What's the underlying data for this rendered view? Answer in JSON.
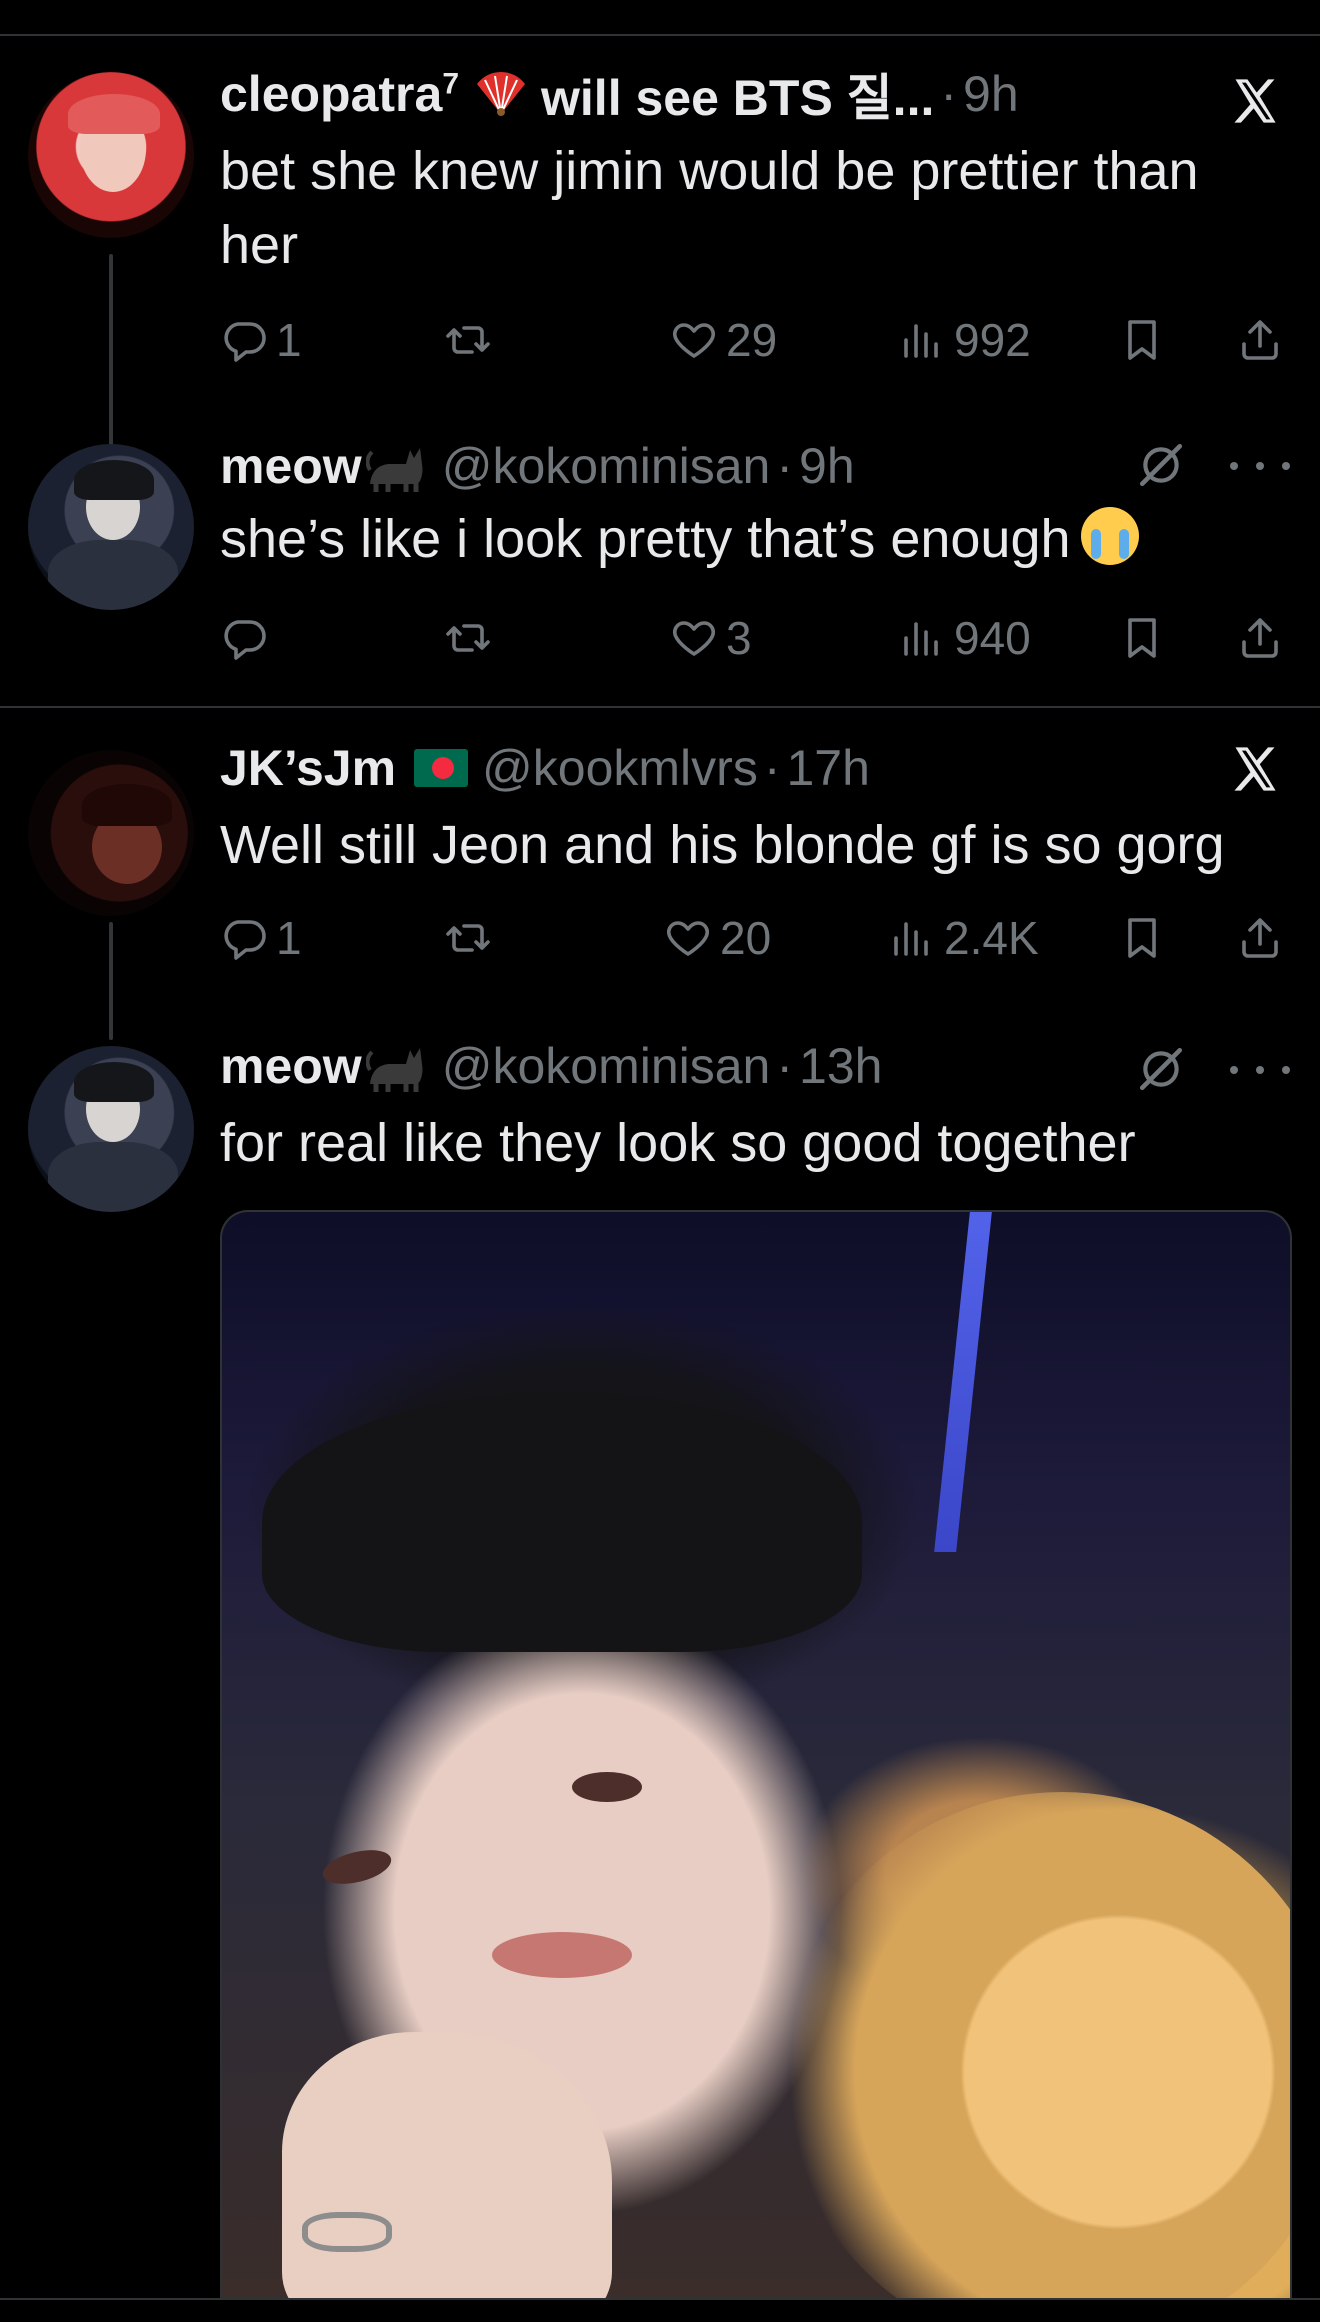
{
  "tweets": [
    {
      "name": "cleopatra",
      "name_sup": "7",
      "name_suffix": "will see BTS 질...",
      "handle": "",
      "time": "9h",
      "text": "bet she knew jimin would be prettier than her",
      "replies": "1",
      "reposts": "",
      "likes": "29",
      "views": "992",
      "corner_icon": "x-logo-icon"
    },
    {
      "name": "meow",
      "handle": "@kokominisan",
      "time": "9h",
      "text": "she’s like i look pretty that’s enough",
      "replies": "",
      "reposts": "",
      "likes": "3",
      "views": "940",
      "corner_icon": "grok-icon"
    },
    {
      "name": "JK’sJm",
      "handle": "@kookmlvrs",
      "time": "17h",
      "text": "Well still Jeon and his blonde gf is so gorg",
      "replies": "1",
      "reposts": "",
      "likes": "20",
      "views": "2.4K",
      "corner_icon": "x-logo-icon"
    },
    {
      "name": "meow",
      "handle": "@kokominisan",
      "time": "13h",
      "text": "for real like they look so good together",
      "corner_icon": "grok-icon"
    }
  ],
  "separator": "·",
  "colors": {
    "background": "#000000",
    "text": "#e7e9ea",
    "muted": "#71767b",
    "divider": "#2f3336"
  }
}
